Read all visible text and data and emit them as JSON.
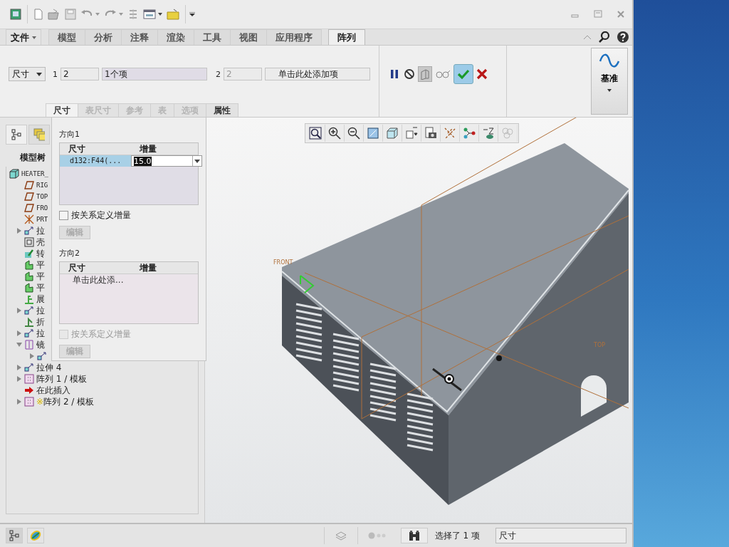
{
  "tabs": [
    {
      "label": "文件",
      "selected": false,
      "menu": true
    },
    {
      "label": "模型",
      "selected": false,
      "menu": false
    },
    {
      "label": "分析",
      "selected": false,
      "menu": false
    },
    {
      "label": "注释",
      "selected": false,
      "menu": false
    },
    {
      "label": "渲染",
      "selected": false,
      "menu": false
    },
    {
      "label": "工具",
      "selected": false,
      "menu": false
    },
    {
      "label": "视图",
      "selected": false,
      "menu": false
    },
    {
      "label": "应用程序",
      "selected": false,
      "menu": false
    },
    {
      "label": "阵列",
      "selected": true,
      "menu": false
    }
  ],
  "dashboard": {
    "type_dropdown": "尺寸",
    "dir1_label": "1",
    "dir1_count": "2",
    "dir1_collector": "1个项",
    "dir2_label": "2",
    "dir2_count": "2",
    "dir2_collector": "单击此处添加项",
    "tools": [
      {
        "pressed": false
      },
      {
        "pressed": false
      },
      {
        "pressed": true
      },
      {
        "pressed": false
      },
      {
        "pressed": true
      },
      {
        "pressed": false
      }
    ],
    "datum_button": "基准"
  },
  "subtabs": [
    {
      "label": "尺寸",
      "selected": true,
      "disabled": false
    },
    {
      "label": "表尺寸",
      "selected": false,
      "disabled": true
    },
    {
      "label": "参考",
      "selected": false,
      "disabled": true
    },
    {
      "label": "表",
      "selected": false,
      "disabled": true
    },
    {
      "label": "选项",
      "selected": false,
      "disabled": true
    },
    {
      "label": "属性",
      "selected": false,
      "disabled": false
    }
  ],
  "dimensions_panel": {
    "direction1": {
      "title": "方向1",
      "columns": [
        "尺寸",
        "增量"
      ],
      "rows": [
        {
          "dimension": "d132:F44(...",
          "increment": "15.0",
          "selected": true
        }
      ],
      "relation_checkbox": {
        "label": "按关系定义增量",
        "checked": false,
        "disabled": false
      },
      "edit_button": {
        "label": "编辑",
        "disabled": true
      }
    },
    "direction2": {
      "title": "方向2",
      "columns": [
        "尺寸",
        "增量"
      ],
      "placeholder_row": "单击此处添...",
      "relation_checkbox": {
        "label": "按关系定义增量",
        "checked": false,
        "disabled": true
      },
      "edit_button": {
        "label": "编辑",
        "disabled": true
      }
    }
  },
  "model_tree": {
    "tabs": [
      {
        "selected": true
      },
      {
        "selected": false
      }
    ],
    "title": "模型树",
    "items": [
      {
        "kind": "part",
        "label": "HEATER_",
        "children": [
          {
            "kind": "plane",
            "label": "RIG"
          },
          {
            "kind": "plane",
            "label": "TOP"
          },
          {
            "kind": "plane",
            "label": "FRO"
          },
          {
            "kind": "csys",
            "label": "PRT"
          },
          {
            "kind": "extrude",
            "label": "拉",
            "expanded": false
          },
          {
            "kind": "shell",
            "label": "壳"
          },
          {
            "kind": "convert",
            "label": "转"
          },
          {
            "kind": "flat",
            "label": "平"
          },
          {
            "kind": "flat",
            "label": "平"
          },
          {
            "kind": "flat",
            "label": "平"
          },
          {
            "kind": "unbend",
            "label": "展"
          },
          {
            "kind": "extrude",
            "label": "拉",
            "expanded": false
          },
          {
            "kind": "bendback",
            "label": "折"
          },
          {
            "kind": "extrude",
            "label": "拉",
            "expanded": false
          },
          {
            "kind": "mirror",
            "label": "镜",
            "expanded": true,
            "children": [
              {
                "kind": "extrude",
                "expanded": false
              }
            ]
          },
          {
            "kind": "extrude",
            "label": "拉伸 4",
            "expanded": false
          },
          {
            "kind": "pattern",
            "label": "阵列 1 / 模板",
            "expanded": false
          },
          {
            "kind": "insert",
            "label": "在此插入"
          },
          {
            "kind": "pattern",
            "prefix": "※",
            "label": "阵列 2 / 模板",
            "expanded": false
          }
        ]
      }
    ]
  },
  "view_toolbar": [
    {
      "disabled": false
    },
    {
      "disabled": false
    },
    {
      "disabled": false
    },
    {
      "disabled": false
    },
    {
      "disabled": false
    },
    {
      "disabled": false
    },
    {
      "disabled": false
    },
    {
      "disabled": false
    },
    {
      "disabled": false
    },
    {
      "disabled": false
    },
    {
      "disabled": true
    }
  ],
  "viewport": {
    "datum_labels": [
      "FRONT",
      "TOP"
    ]
  },
  "status_bar": {
    "message": "选择了 1 项",
    "filter": "尺寸"
  }
}
